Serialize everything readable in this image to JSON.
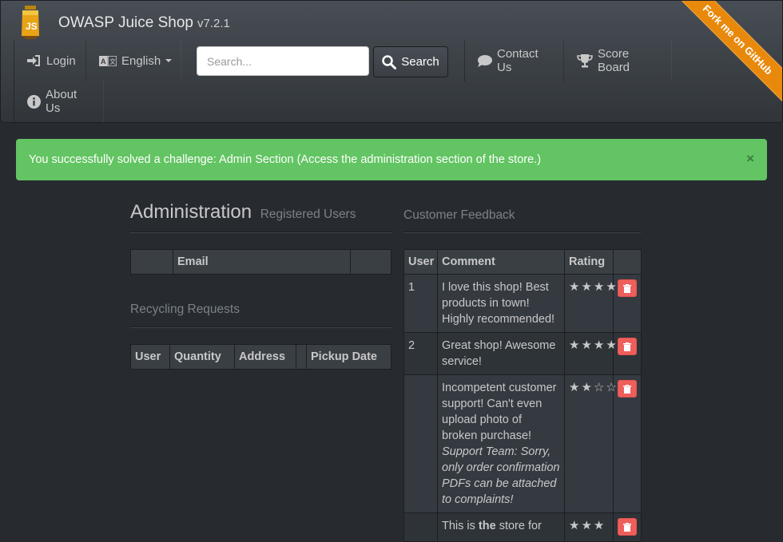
{
  "header": {
    "title": "OWASP Juice Shop",
    "version": "v7.2.1",
    "nav": {
      "login": "Login",
      "language": "English",
      "contact": "Contact Us",
      "score_board": "Score Board",
      "about": "About Us"
    },
    "search": {
      "placeholder": "Search...",
      "button": "Search"
    },
    "ribbon": "Fork me on GitHub"
  },
  "alert": {
    "message": "You successfully solved a challenge: Admin Section (Access the administration section of the store.)",
    "close": "×"
  },
  "admin": {
    "title": "Administration",
    "subtitle": "Registered Users",
    "users_table": {
      "headers": [
        "",
        "Email",
        ""
      ]
    },
    "recycling_title": "Recycling Requests",
    "recycling_table": {
      "headers": [
        "User",
        "Quantity",
        "Address",
        "",
        "Pickup Date"
      ]
    }
  },
  "feedback": {
    "title": "Customer Feedback",
    "headers": [
      "User",
      "Comment",
      "Rating",
      ""
    ],
    "rows": [
      {
        "user": "1",
        "comment": "I love this shop! Best products in town! Highly recommended!",
        "reply": "",
        "stars": "★★★★★"
      },
      {
        "user": "2",
        "comment": "Great shop! Awesome service!",
        "reply": "",
        "stars": "★★★★☆"
      },
      {
        "user": "",
        "comment": "Incompetent customer support! Can't even upload photo of broken purchase!",
        "reply": "Support Team: Sorry, only order confirmation PDFs can be attached to complaints!",
        "stars": "★★☆☆☆"
      },
      {
        "user": "",
        "comment_pre": "This is ",
        "comment_bold": "the",
        "comment_post": " store for",
        "stars": "★★★"
      }
    ]
  },
  "colors": {
    "success": "#62c462",
    "danger": "#ee5f5b",
    "ribbon": "#e8890c"
  }
}
